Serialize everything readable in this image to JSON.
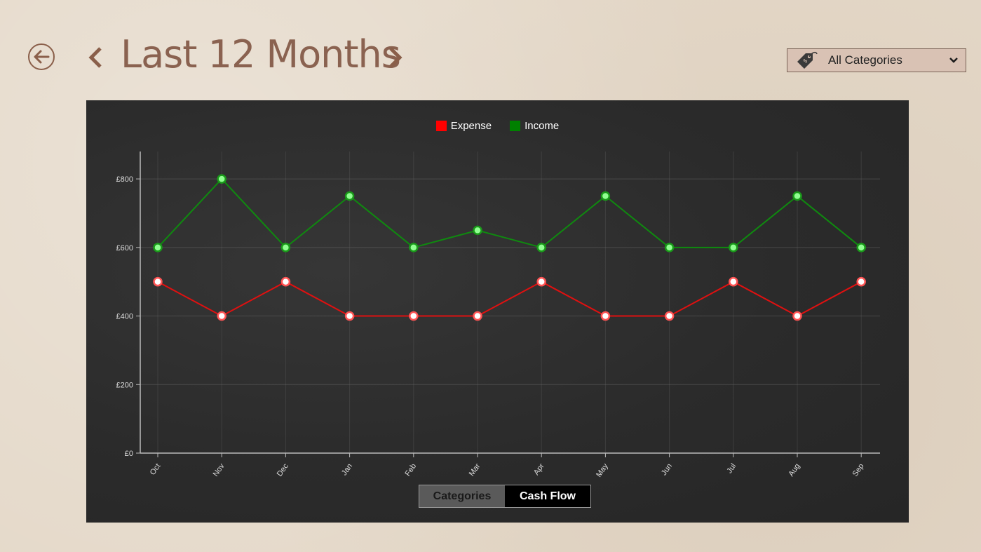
{
  "header": {
    "title": "Last 12 Months",
    "category_select": {
      "selected": "All Categories"
    }
  },
  "colors": {
    "accent": "#8a6250",
    "expense": "#ff0000",
    "income": "#008000"
  },
  "icons": {
    "back": "back-arrow-circle-icon",
    "prev": "chevron-left-icon",
    "next": "chevron-right-icon",
    "category": "price-tag-icon",
    "dropdown": "chevron-down-icon"
  },
  "view_toggle": {
    "categories_label": "Categories",
    "cashflow_label": "Cash Flow",
    "active": "Cash Flow"
  },
  "chart_data": {
    "type": "line",
    "x": [
      "Oct",
      "Nov",
      "Dec",
      "Jan",
      "Feb",
      "Mar",
      "Apr",
      "May",
      "Jun",
      "Jul",
      "Aug",
      "Sep"
    ],
    "series": [
      {
        "name": "Expense",
        "color": "#ff0000",
        "values": [
          500,
          400,
          500,
          400,
          400,
          400,
          500,
          400,
          400,
          500,
          400,
          500
        ]
      },
      {
        "name": "Income",
        "color": "#008000",
        "values": [
          600,
          800,
          600,
          750,
          600,
          650,
          600,
          750,
          600,
          600,
          750,
          600
        ]
      }
    ],
    "yticks": [
      0,
      200,
      400,
      600,
      800
    ],
    "ytick_labels": [
      "£0",
      "£200",
      "£400",
      "£600",
      "£800"
    ],
    "ylim": [
      0,
      880
    ],
    "grid": true,
    "legend": "top-center"
  }
}
